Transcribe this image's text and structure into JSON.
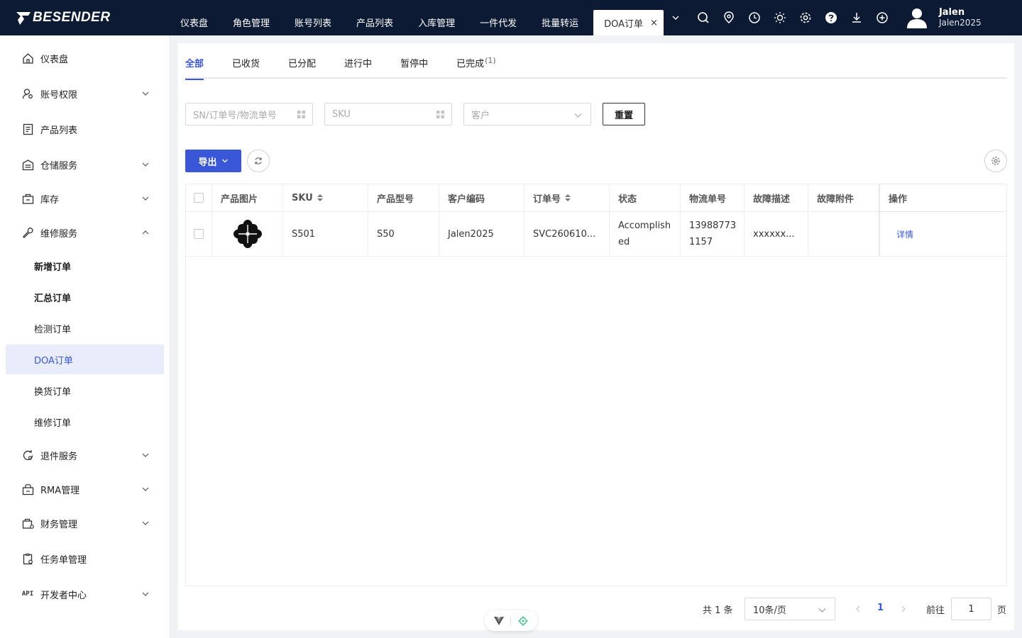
{
  "brand": {
    "name": "BESENDER"
  },
  "nav": {
    "items": [
      "仪表盘",
      "角色管理",
      "账号列表",
      "产品列表",
      "入库管理",
      "一件代发",
      "批量转运"
    ],
    "active": "DOA订单",
    "close_glyph": "×"
  },
  "user": {
    "name": "Jalen",
    "id": "Jalen2025"
  },
  "sidebar": {
    "items": [
      {
        "label": "仪表盘",
        "icon": "home-icon"
      },
      {
        "label": "账号权限",
        "icon": "user-key-icon"
      },
      {
        "label": "产品列表",
        "icon": "list-icon"
      },
      {
        "label": "仓储服务",
        "icon": "warehouse-icon"
      },
      {
        "label": "库存",
        "icon": "inventory-icon"
      },
      {
        "label": "维修服务",
        "icon": "wrench-icon"
      },
      {
        "label": "退件服务",
        "icon": "return-icon"
      },
      {
        "label": "RMA管理",
        "icon": "rma-icon"
      },
      {
        "label": "财务管理",
        "icon": "finance-icon"
      },
      {
        "label": "任务单管理",
        "icon": "task-icon"
      },
      {
        "label": "开发者中心",
        "icon": "api-icon",
        "prefix": "API"
      }
    ],
    "sub": [
      "新增订单",
      "汇总订单",
      "检测订单",
      "DOA订单",
      "换货订单",
      "维修订单"
    ]
  },
  "tabs": [
    {
      "label": "全部"
    },
    {
      "label": "已收货"
    },
    {
      "label": "已分配"
    },
    {
      "label": "进行中"
    },
    {
      "label": "暂停中"
    },
    {
      "label": "已完成",
      "count": "(1)"
    }
  ],
  "filters": {
    "sn_placeholder": "SN/订单号/物流单号",
    "sku_placeholder": "SKU",
    "customer_placeholder": "客户",
    "reset_label": "重置"
  },
  "toolbar": {
    "export_label": "导出"
  },
  "table": {
    "headers": {
      "image": "产品图片",
      "sku": "SKU",
      "model": "产品型号",
      "customer_code": "客户编码",
      "order_no": "订单号",
      "status": "状态",
      "tracking": "物流单号",
      "fault_desc": "故障描述",
      "fault_attach": "故障附件",
      "ops": "操作"
    },
    "rows": [
      {
        "sku": "S501",
        "model": "S50",
        "customer_code": "Jalen2025",
        "order_no": "SVC260610...",
        "status": "Accomplished",
        "tracking": "13988773 1157",
        "fault_desc": "xxxxxx...",
        "fault_attach": "",
        "op_label": "详情"
      }
    ]
  },
  "pager": {
    "total": "共 1 条",
    "page_size": "10条/页",
    "current": "1",
    "goto_label": "前往",
    "goto_value": "1",
    "page_unit": "页"
  },
  "colors": {
    "topbar": "#0c1b33",
    "primary": "#3a57d8",
    "active_bg": "#e8ecfb"
  }
}
